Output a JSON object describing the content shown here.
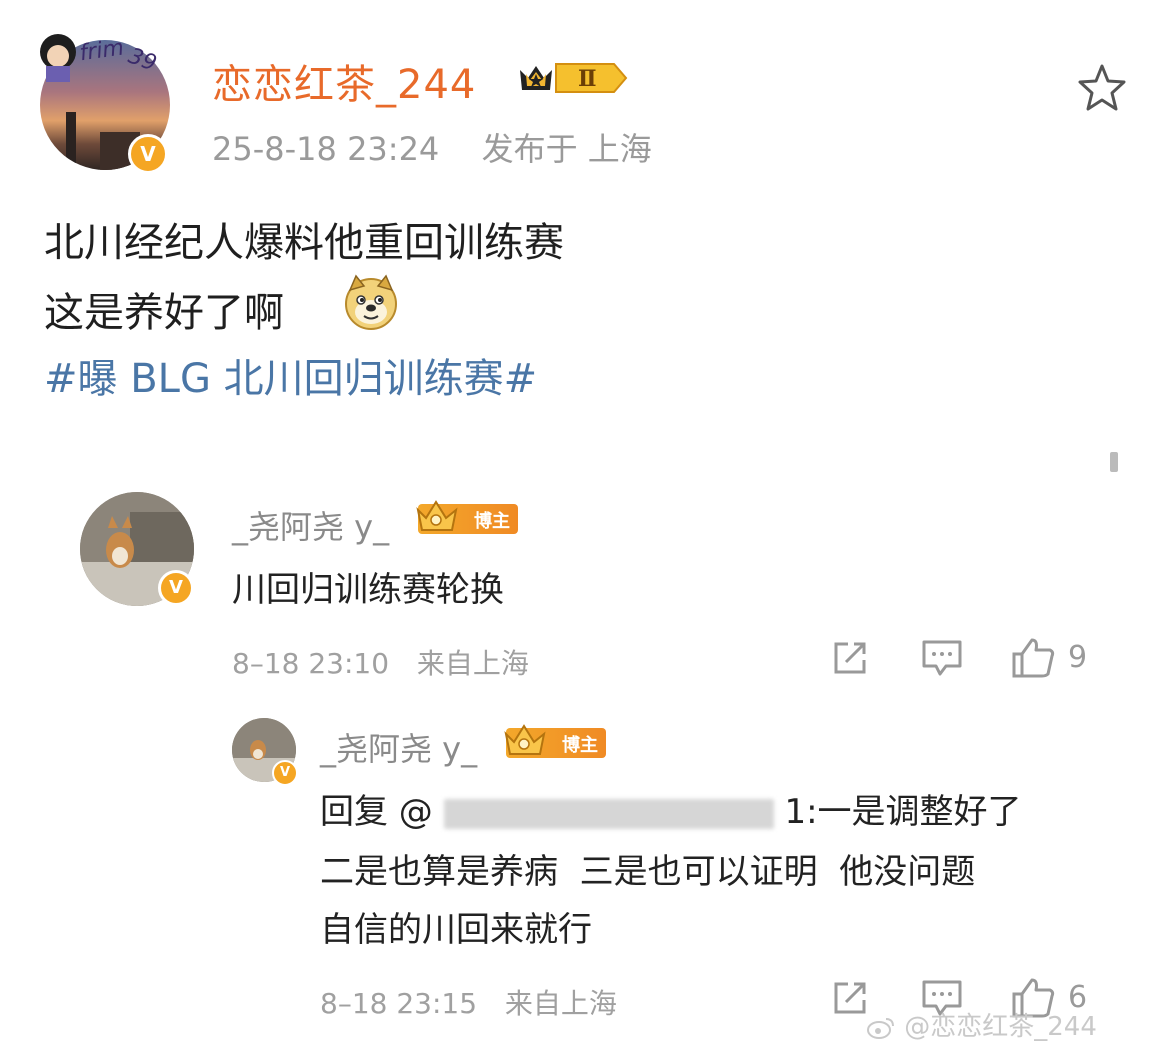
{
  "post": {
    "author": "恋恋红茶_244",
    "level_badge": "Ⅱ",
    "verified_mark": "V",
    "timestamp": "25-8-18 23:24",
    "location": "发布于 上海",
    "text_line1": "北川经纪人爆料他重回训练赛",
    "text_line2": "这是养好了啊",
    "hashtag": "#曝 BLG 北川回归训练赛#",
    "emoji": "doge-emoji",
    "favorite_icon": "star-outline-icon"
  },
  "comments": [
    {
      "author": "_尧阿尧 y_",
      "badge": "博主",
      "verified_mark": "V",
      "text": "川回归训练赛轮换",
      "timestamp": "8–18 23:10",
      "location": "来自上海",
      "likes": "9"
    },
    {
      "author": "_尧阿尧 y_",
      "badge": "博主",
      "verified_mark": "V",
      "reply_prefix": "回复 @",
      "reply_target_suffix": "1:一是调整好了",
      "text_line2": "二是也算是养病  三是也可以证明  他没问题",
      "text_line3": "自信的川回来就行",
      "timestamp": "8–18 23:15",
      "location": "来自上海",
      "likes": "6"
    }
  ],
  "watermark": "@恋恋红茶_244",
  "colors": {
    "username": "#e86a2a",
    "hashtag": "#4a76a6",
    "badge_gold": "#f3a82b",
    "meta_gray": "#9a9a9a"
  }
}
